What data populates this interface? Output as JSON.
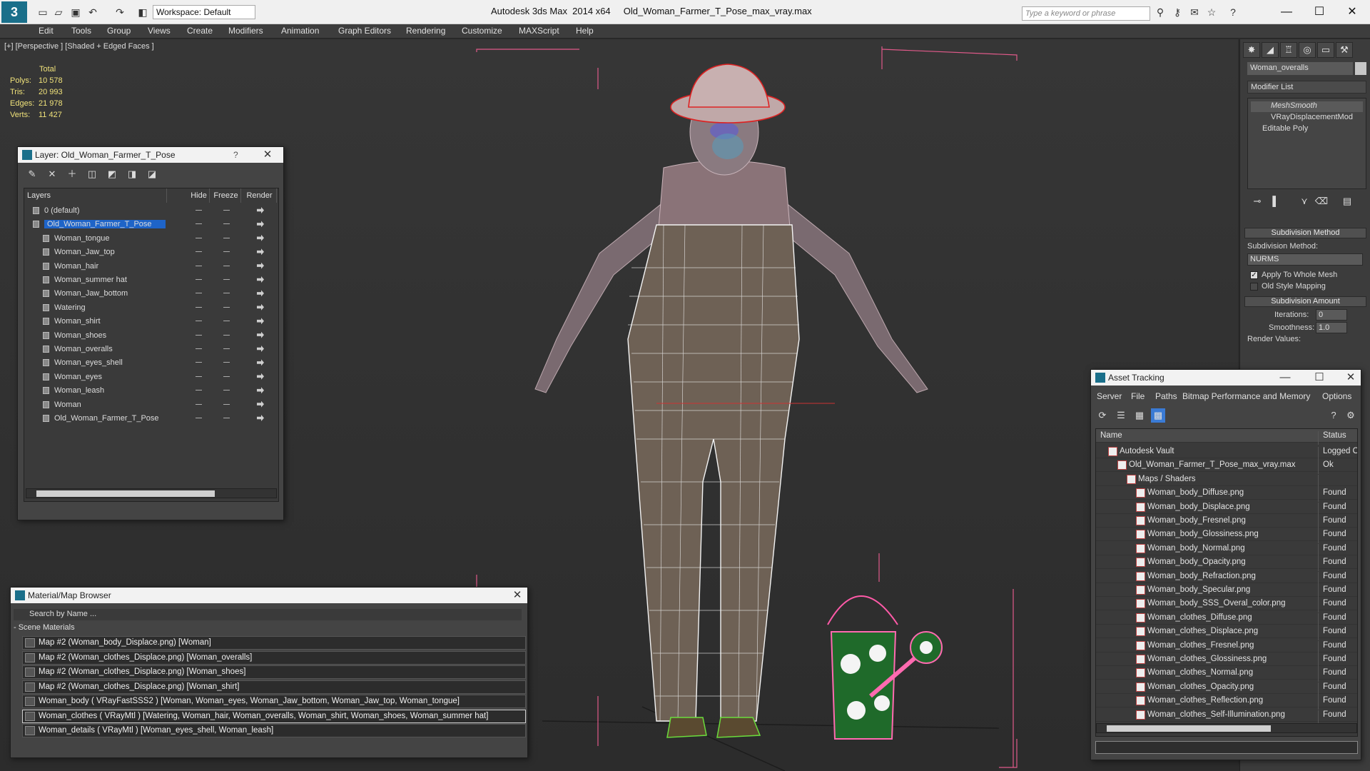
{
  "app": {
    "title": "Autodesk 3ds Max  2014 x64     Old_Woman_Farmer_T_Pose_max_vray.max",
    "workspace": "Workspace: Default",
    "search_placeholder": "Type a keyword or phrase",
    "logo_text": "3"
  },
  "menu": [
    "Edit",
    "Tools",
    "Group",
    "Views",
    "Create",
    "Modifiers",
    "Animation",
    "Graph Editors",
    "Rendering",
    "Customize",
    "MAXScript",
    "Help"
  ],
  "viewport": {
    "label": "[+] [Perspective ] [Shaded + Edged Faces ]",
    "stats": {
      "header": "Total",
      "rows": [
        {
          "k": "Polys:",
          "v": "10 578"
        },
        {
          "k": "Tris:",
          "v": "20 993"
        },
        {
          "k": "Edges:",
          "v": "21 978"
        },
        {
          "k": "Verts:",
          "v": "11 427"
        }
      ]
    }
  },
  "command_panel": {
    "object_name": "Woman_overalls",
    "modifier_list": "Modifier List",
    "stack": [
      "MeshSmooth",
      "VRayDisplacementMod",
      "Editable Poly"
    ],
    "subdivision_method_head": "Subdivision Method",
    "subdivision_method_label": "Subdivision Method:",
    "subdivision_method_value": "NURMS",
    "apply_whole_mesh": "Apply To Whole Mesh",
    "old_style_mapping": "Old Style Mapping",
    "subdivision_amount_head": "Subdivision Amount",
    "iterations_label": "Iterations:",
    "iterations_value": "0",
    "smoothness_label": "Smoothness:",
    "smoothness_value": "1.0",
    "render_values": "Render Values:"
  },
  "layer_dialog": {
    "title": "Layer: Old_Woman_Farmer_T_Pose",
    "help": "?",
    "columns": [
      "Layers",
      "Hide",
      "Freeze",
      "Render"
    ],
    "rows": [
      {
        "name": "0 (default)",
        "indent": 0,
        "selected": false
      },
      {
        "name": "Old_Woman_Farmer_T_Pose",
        "indent": 0,
        "selected": true
      },
      {
        "name": "Woman_tongue",
        "indent": 1,
        "selected": false
      },
      {
        "name": "Woman_Jaw_top",
        "indent": 1,
        "selected": false
      },
      {
        "name": "Woman_hair",
        "indent": 1,
        "selected": false
      },
      {
        "name": "Woman_summer hat",
        "indent": 1,
        "selected": false
      },
      {
        "name": "Woman_Jaw_bottom",
        "indent": 1,
        "selected": false
      },
      {
        "name": "Watering",
        "indent": 1,
        "selected": false
      },
      {
        "name": "Woman_shirt",
        "indent": 1,
        "selected": false
      },
      {
        "name": "Woman_shoes",
        "indent": 1,
        "selected": false
      },
      {
        "name": "Woman_overalls",
        "indent": 1,
        "selected": false
      },
      {
        "name": "Woman_eyes_shell",
        "indent": 1,
        "selected": false
      },
      {
        "name": "Woman_eyes",
        "indent": 1,
        "selected": false
      },
      {
        "name": "Woman_leash",
        "indent": 1,
        "selected": false
      },
      {
        "name": "Woman",
        "indent": 1,
        "selected": false
      },
      {
        "name": "Old_Woman_Farmer_T_Pose",
        "indent": 1,
        "selected": false
      }
    ]
  },
  "material_browser": {
    "title": "Material/Map Browser",
    "search_placeholder": "Search by Name ...",
    "section": "- Scene Materials",
    "items": [
      "Map #2 (Woman_body_Displace.png) [Woman]",
      "Map #2 (Woman_clothes_Displace.png) [Woman_overalls]",
      "Map #2 (Woman_clothes_Displace.png) [Woman_shoes]",
      "Map #2 (Woman_clothes_Displace.png) [Woman_shirt]",
      "Woman_body  ( VRayFastSSS2 )  [Woman, Woman_eyes, Woman_Jaw_bottom, Woman_Jaw_top, Woman_tongue]",
      "Woman_clothes  ( VRayMtl )  [Watering, Woman_hair, Woman_overalls, Woman_shirt, Woman_shoes, Woman_summer hat]",
      "Woman_details  ( VRayMtl )  [Woman_eyes_shell, Woman_leash]"
    ]
  },
  "asset_tracking": {
    "title": "Asset Tracking",
    "menu": [
      "Server",
      "File",
      "Paths",
      "Bitmap Performance and Memory",
      "Options"
    ],
    "columns": [
      "Name",
      "Status"
    ],
    "rows": [
      {
        "name": "Autodesk Vault",
        "status": "Logged Ou",
        "indent": 1
      },
      {
        "name": "Old_Woman_Farmer_T_Pose_max_vray.max",
        "status": "Ok",
        "indent": 2
      },
      {
        "name": "Maps / Shaders",
        "status": "",
        "indent": 3
      },
      {
        "name": "Woman_body_Diffuse.png",
        "status": "Found",
        "indent": 4
      },
      {
        "name": "Woman_body_Displace.png",
        "status": "Found",
        "indent": 4
      },
      {
        "name": "Woman_body_Fresnel.png",
        "status": "Found",
        "indent": 4
      },
      {
        "name": "Woman_body_Glossiness.png",
        "status": "Found",
        "indent": 4
      },
      {
        "name": "Woman_body_Normal.png",
        "status": "Found",
        "indent": 4
      },
      {
        "name": "Woman_body_Opacity.png",
        "status": "Found",
        "indent": 4
      },
      {
        "name": "Woman_body_Refraction.png",
        "status": "Found",
        "indent": 4
      },
      {
        "name": "Woman_body_Specular.png",
        "status": "Found",
        "indent": 4
      },
      {
        "name": "Woman_body_SSS_Overal_color.png",
        "status": "Found",
        "indent": 4
      },
      {
        "name": "Woman_clothes_Diffuse.png",
        "status": "Found",
        "indent": 4
      },
      {
        "name": "Woman_clothes_Displace.png",
        "status": "Found",
        "indent": 4
      },
      {
        "name": "Woman_clothes_Fresnel.png",
        "status": "Found",
        "indent": 4
      },
      {
        "name": "Woman_clothes_Glossiness.png",
        "status": "Found",
        "indent": 4
      },
      {
        "name": "Woman_clothes_Normal.png",
        "status": "Found",
        "indent": 4
      },
      {
        "name": "Woman_clothes_Opacity.png",
        "status": "Found",
        "indent": 4
      },
      {
        "name": "Woman_clothes_Reflection.png",
        "status": "Found",
        "indent": 4
      },
      {
        "name": "Woman_clothes_Self-Illumination.png",
        "status": "Found",
        "indent": 4
      }
    ]
  },
  "colors": {
    "selection_blue": "#1e64c8",
    "bbox_pink": "#e05a8a",
    "stats_yellow": "#f0e27a"
  }
}
